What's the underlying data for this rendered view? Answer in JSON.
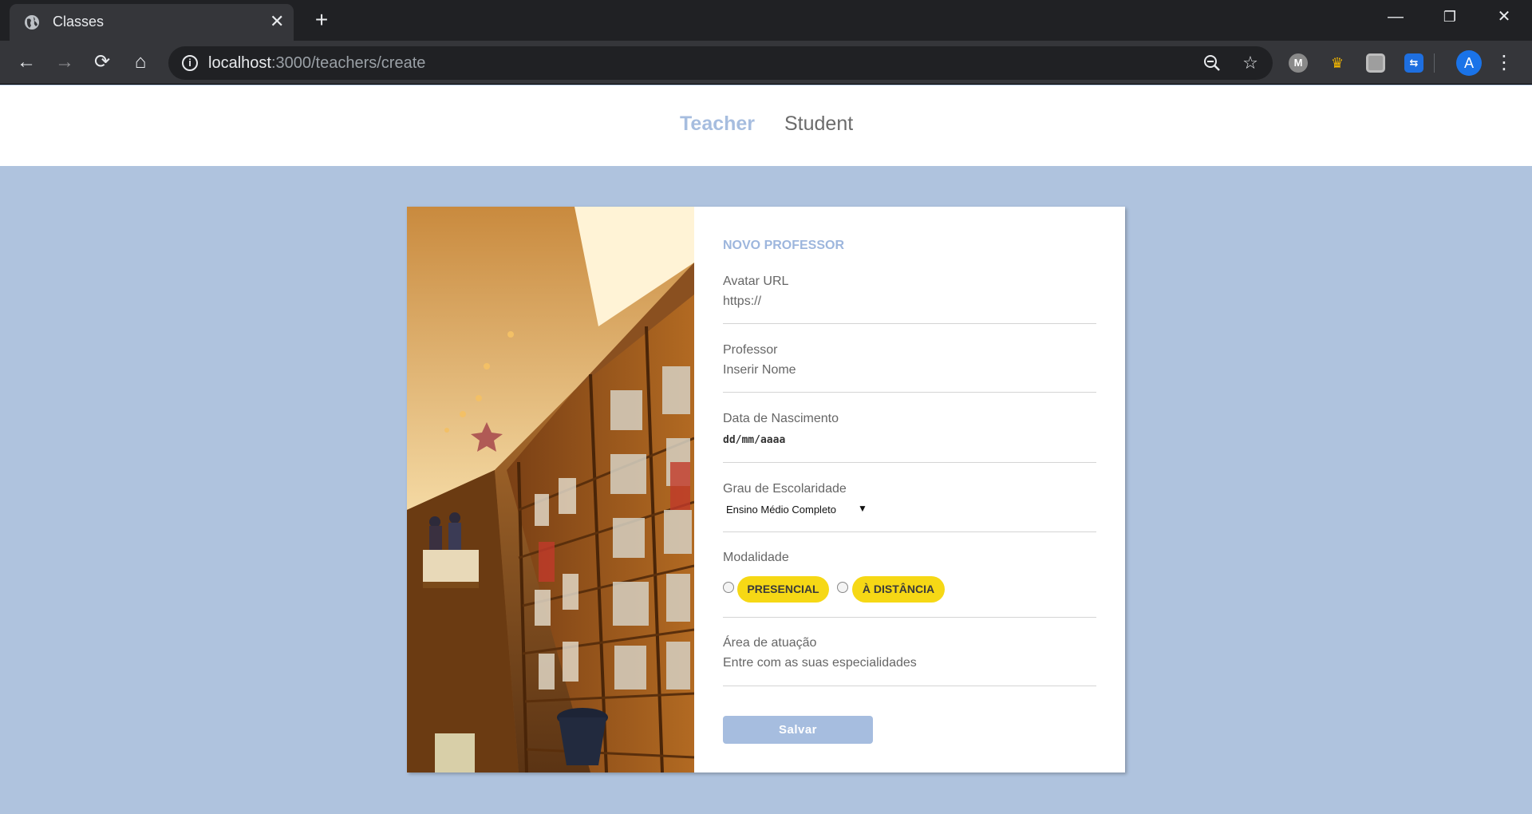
{
  "browser": {
    "tab_title": "Classes",
    "tab_close": "✕",
    "new_tab": "+",
    "url_host": "localhost",
    "url_path": ":3000/teachers/create",
    "avatar_letter": "A",
    "window_controls": [
      "—",
      "❐",
      "✕"
    ],
    "icons": [
      "globe-icon",
      "back-icon",
      "forward-icon",
      "reload-icon",
      "home-icon",
      "info-icon",
      "zoom-out-icon",
      "star-icon",
      "menu-icon"
    ]
  },
  "nav": {
    "items": [
      {
        "label": "Teacher",
        "active": true
      },
      {
        "label": "Student",
        "active": false
      }
    ]
  },
  "form": {
    "title": "NOVO PROFESSOR",
    "avatar": {
      "label": "Avatar URL",
      "placeholder": "https://"
    },
    "name": {
      "label": "Professor",
      "placeholder": "Inserir Nome"
    },
    "birth": {
      "label": "Data de Nascimento",
      "placeholder": "dd/mm/aaaa"
    },
    "education": {
      "label": "Grau de Escolaridade",
      "selected": "Ensino Médio Completo"
    },
    "mode": {
      "label": "Modalidade",
      "options": [
        "PRESENCIAL",
        "À DISTÂNCIA"
      ]
    },
    "area": {
      "label": "Área de atuação",
      "placeholder": "Entre com as suas especialidades"
    },
    "submit": "Salvar"
  },
  "colors": {
    "page_bg": "#afc3de",
    "accent": "#a6bddf",
    "pill": "#f6d815",
    "title": "#9db6dd"
  }
}
